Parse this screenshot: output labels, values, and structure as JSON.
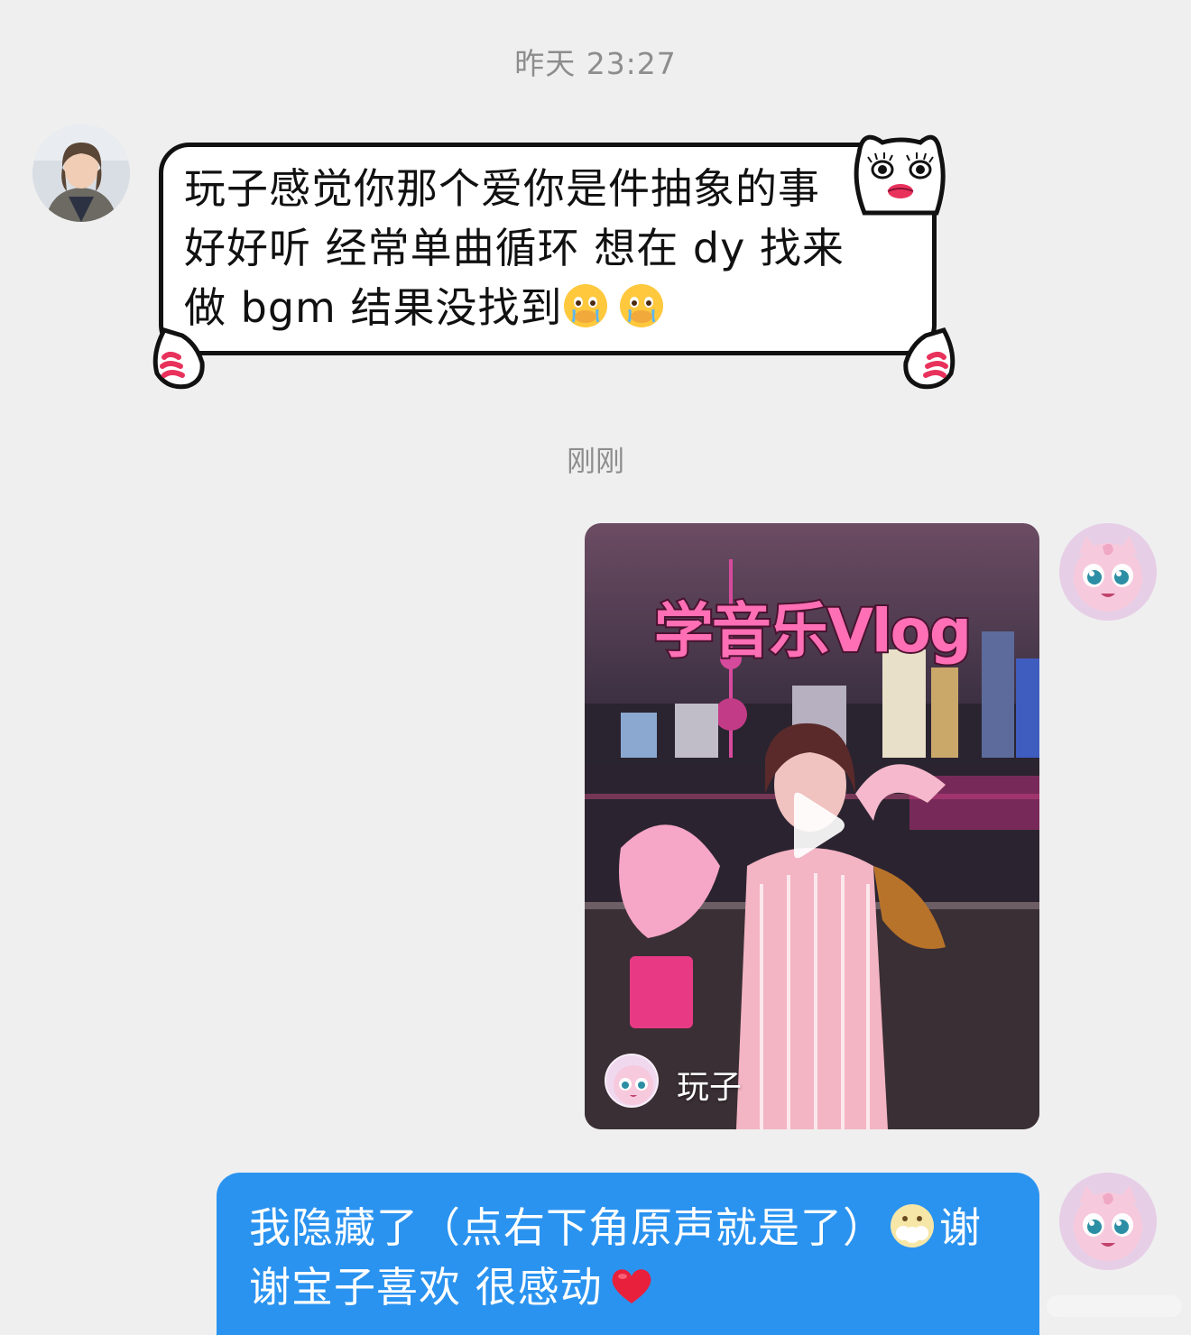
{
  "timestamps": {
    "first": "昨天 23:27",
    "second": "刚刚"
  },
  "incoming_message": {
    "lines": [
      "玩子感觉你那个爱你是件抽象的事",
      "好好听 经常单曲循环 想在 dy 找来",
      "做 bgm 结果没找到"
    ],
    "emoji": [
      "crying-face-holding-back-tears",
      "crying-face-holding-back-tears"
    ]
  },
  "video_card": {
    "title": "学音乐Vlog",
    "author_name": "玩子",
    "play_icon": "play-icon"
  },
  "outgoing_message": {
    "line1_prefix": "我隐藏了（点右下角原声就是了）",
    "line1_suffix": "谢",
    "line2": "谢宝子喜欢 很感动",
    "emoji": [
      "face-with-open-mouth-foam",
      "red-heart"
    ]
  },
  "colors": {
    "background": "#efefef",
    "outgoing_bubble": "#2a93f0",
    "timestamp_text": "#8d8d8d",
    "video_title": "#ff6fb5"
  }
}
